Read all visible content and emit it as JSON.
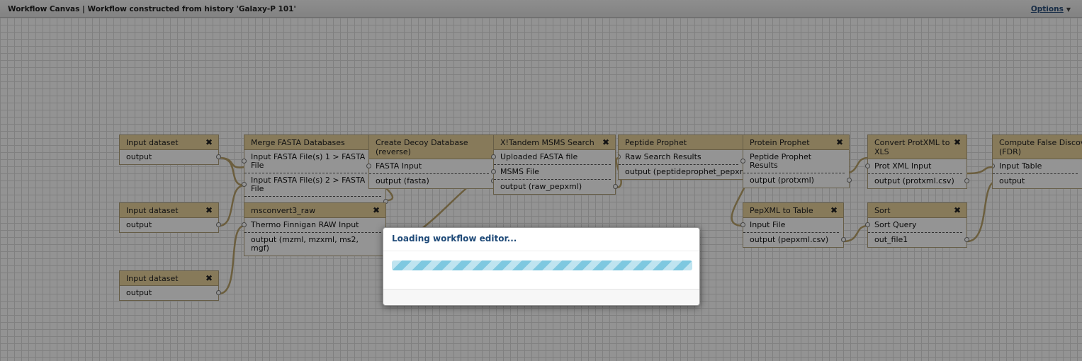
{
  "header": {
    "title": "Workflow Canvas | Workflow constructed from history 'Galaxy-P 101'",
    "options_label": "Options"
  },
  "nodes": [
    {
      "title": "Input dataset",
      "outputs": [
        "output"
      ]
    },
    {
      "title": "Input dataset",
      "outputs": [
        "output"
      ]
    },
    {
      "title": "Input dataset",
      "outputs": [
        "output"
      ]
    },
    {
      "title": "Merge FASTA Databases",
      "inputs": [
        "Input FASTA File(s) 1 > FASTA File",
        "Input FASTA File(s) 2 > FASTA File"
      ],
      "outputs": [
        ""
      ]
    },
    {
      "title": "msconvert3_raw",
      "inputs": [
        "Thermo Finnigan RAW Input"
      ],
      "outputs": [
        "output (mzml, mzxml, ms2, mgf)"
      ]
    },
    {
      "title": "Create Decoy Database (reverse)",
      "inputs": [
        "FASTA Input"
      ],
      "outputs": [
        "output (fasta)"
      ]
    },
    {
      "title": "X!Tandem MSMS Search",
      "inputs": [
        "Uploaded FASTA file",
        "MSMS File"
      ],
      "outputs": [
        "output (raw_pepxml)"
      ]
    },
    {
      "title": "Peptide Prophet",
      "inputs": [
        "Raw Search Results"
      ],
      "outputs": [
        "output (peptideprophet_pepxml)"
      ]
    },
    {
      "title": "Protein Prophet",
      "inputs": [
        "Peptide Prophet Results"
      ],
      "outputs": [
        "output (protxml)"
      ]
    },
    {
      "title": "PepXML to Table",
      "inputs": [
        "Input File"
      ],
      "outputs": [
        "output (pepxml.csv)"
      ]
    },
    {
      "title": "Convert ProtXML to XLS",
      "inputs": [
        "Prot XML Input"
      ],
      "outputs": [
        "output (protxml.csv)"
      ]
    },
    {
      "title": "Sort",
      "inputs": [
        "Sort Query"
      ],
      "outputs": [
        "out_file1"
      ]
    },
    {
      "title": "Compute False Discovery Rate (FDR)",
      "inputs": [
        "Input Table"
      ],
      "outputs": [
        "output"
      ]
    }
  ],
  "modal": {
    "title": "Loading workflow editor..."
  },
  "icons": {
    "close": "close-icon",
    "options_caret": "caret-down-icon"
  }
}
